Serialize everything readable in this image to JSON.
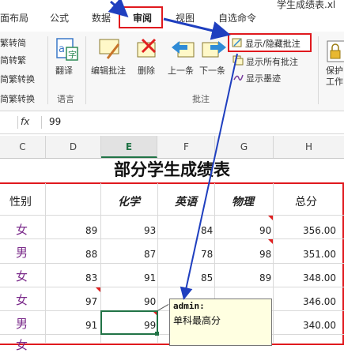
{
  "tabs": [
    "面布局",
    "公式",
    "数据",
    "审阅",
    "视图",
    "自选命令"
  ],
  "window_title": "学生成绩表.xl",
  "ribbon": {
    "chinese_convert": [
      "繁转简",
      "简转繁",
      "简繁转换",
      "简繁转换"
    ],
    "translate": "翻译",
    "language_group": "语言",
    "edit_comment": "编辑批注",
    "delete": "删除",
    "previous": "上一条",
    "next": "下一条",
    "comments_group": "批注",
    "show_hide_comment": "显示/隐藏批注",
    "show_all_comments": "显示所有批注",
    "show_ink": "显示墨迹",
    "protect": "保护",
    "protect_sub": "工作"
  },
  "formula_bar": {
    "fx": "fx",
    "value": "99"
  },
  "columns": [
    "C",
    "D",
    "E",
    "F",
    "G",
    "H"
  ],
  "sheet": {
    "title": "部分学生成绩表",
    "headers": {
      "gender": "性别",
      "chem": "化学",
      "english": "英语",
      "physics": "物理",
      "total": "总分"
    },
    "rows": [
      {
        "gender": "女",
        "d": "89",
        "e": "93",
        "f": "84",
        "g": "90",
        "h": "356.00"
      },
      {
        "gender": "男",
        "d": "88",
        "e": "87",
        "f": "78",
        "g": "98",
        "h": "351.00"
      },
      {
        "gender": "女",
        "d": "83",
        "e": "91",
        "f": "85",
        "g": "89",
        "h": "348.00"
      },
      {
        "gender": "女",
        "d": "97",
        "e": "90",
        "f": "",
        "g": "",
        "h": "346.00"
      },
      {
        "gender": "男",
        "d": "91",
        "e": "99",
        "f": "",
        "g": "",
        "h": "340.00"
      },
      {
        "gender": "女",
        "d": "",
        "e": "",
        "f": "",
        "g": "",
        "h": ""
      }
    ]
  },
  "comment": {
    "author": "admin:",
    "text": "单科最高分"
  },
  "colors": {
    "highlight": "#e0191e",
    "arrow": "#1f3fbf",
    "green": "#217346",
    "gender_female": "#7a2a8a"
  }
}
